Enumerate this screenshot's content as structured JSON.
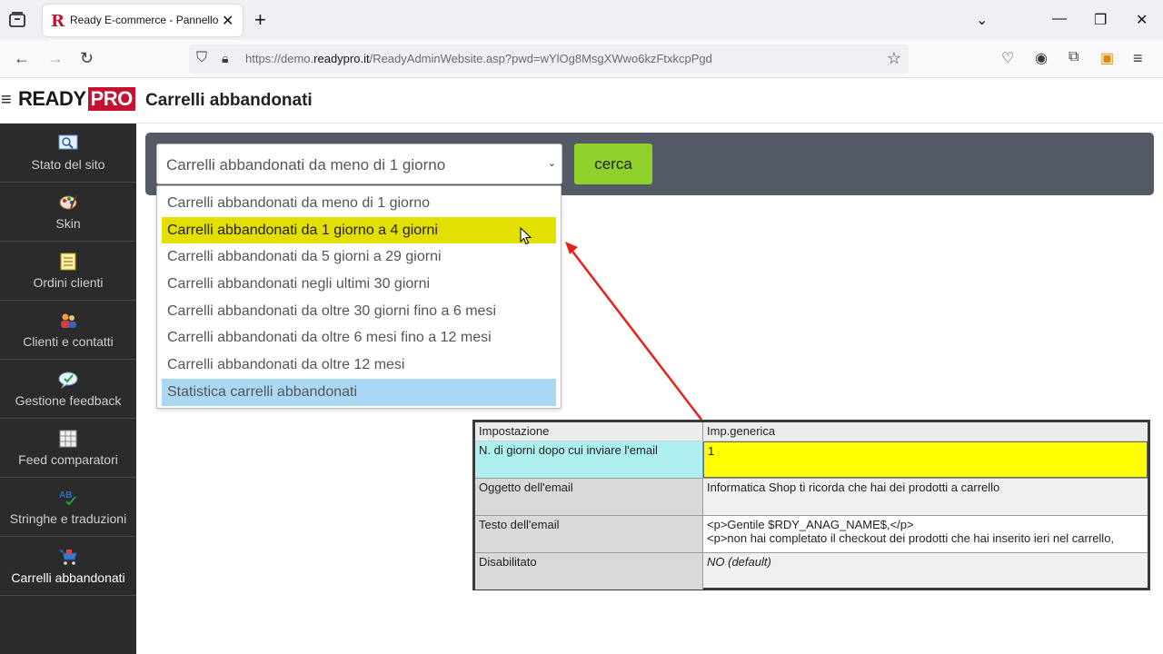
{
  "browser": {
    "tab_title": "Ready E-commerce - Pannello",
    "tab_favicon": "R",
    "url_prefix": "https://demo.",
    "url_domain": "readypro.it",
    "url_path": "/ReadyAdminWebsite.asp?pwd=wYlOg8MsgXWwo6kzFtxkcpPgd"
  },
  "header": {
    "logo_ready": "READY",
    "logo_pro": "PRO",
    "page_title": "Carrelli abbandonati"
  },
  "sidebar": {
    "items": [
      {
        "label": "Stato del sito",
        "icon": "site-status-icon"
      },
      {
        "label": "Skin",
        "icon": "palette-icon"
      },
      {
        "label": "Ordini clienti",
        "icon": "notepad-icon"
      },
      {
        "label": "Clienti e contatti",
        "icon": "contacts-icon"
      },
      {
        "label": "Gestione feedback",
        "icon": "feedback-icon"
      },
      {
        "label": "Feed comparatori",
        "icon": "grid-icon"
      },
      {
        "label": "Stringhe e traduzioni",
        "icon": "translate-icon"
      },
      {
        "label": "Carrelli abbandonati",
        "icon": "cart-icon"
      }
    ]
  },
  "search": {
    "selected": "Carrelli abbandonati da meno di 1 giorno",
    "button": "cerca",
    "options": [
      "Carrelli abbandonati da meno di 1 giorno",
      "Carrelli abbandonati da 1 giorno a 4 giorni",
      "Carrelli abbandonati da 5 giorni a 29 giorni",
      "Carrelli abbandonati negli ultimi 30 giorni",
      "Carrelli abbandonati da oltre 30 giorni fino a 6 mesi",
      "Carrelli abbandonati da oltre 6 mesi fino a 12 mesi",
      "Carrelli abbandonati da oltre 12 mesi",
      "Statistica carrelli abbandonati"
    ]
  },
  "settings_table": {
    "headers": [
      "Impostazione",
      "Imp.generica"
    ],
    "rows": [
      {
        "key": "N. di giorni dopo cui inviare l'email",
        "value": "1"
      },
      {
        "key": "Oggetto dell'email",
        "value": "Informatica Shop ti ricorda che hai dei prodotti a carrello"
      },
      {
        "key": "Testo dell'email",
        "value_line1": "<p>Gentile $RDY_ANAG_NAME$,</p>",
        "value_line2": "<p>non hai completato il checkout dei prodotti che hai inserito ieri nel carrello,"
      },
      {
        "key": "Disabilitato",
        "value": "NO (default)"
      }
    ]
  },
  "colors": {
    "highlight_option": "#e3e000",
    "selected_option": "#aad8f4",
    "cerca_button": "#8fd12a",
    "arrow": "#e8201a"
  }
}
